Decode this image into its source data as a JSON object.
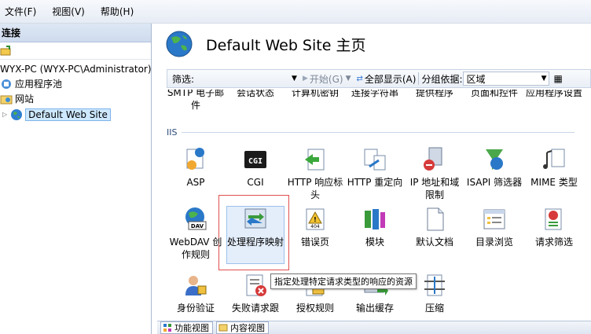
{
  "menu": [
    "文件(F)",
    "视图(V)",
    "帮助(H)"
  ],
  "left": {
    "header": "连接",
    "tree": [
      {
        "label": "WYX-PC (WYX-PC\\Administrator)",
        "icon": "server-icon"
      },
      {
        "label": "应用程序池",
        "icon": "app-pool-icon"
      },
      {
        "label": "网站",
        "icon": "sites-folder-icon"
      },
      {
        "label": "Default Web Site",
        "icon": "globe-icon",
        "selected": true
      }
    ]
  },
  "right": {
    "title": "Default Web Site 主页",
    "filter": {
      "label": "筛选:",
      "start": "开始(G)",
      "show_all": "全部显示(A)",
      "group_by_label": "分组依据:",
      "group_by_value": "区域"
    },
    "section_iis": "IIS",
    "row0": [
      "SMTP 电子邮件",
      "会话状态",
      "计算机密钥",
      "连接字符串",
      "提供程序",
      "页面和控件",
      "应用程序设置"
    ],
    "row1": [
      "ASP",
      "CGI",
      "HTTP 响应标头",
      "HTTP 重定向",
      "IP 地址和域限制",
      "ISAPI 筛选器",
      "MIME 类型"
    ],
    "row2": [
      "WebDAV 创作规则",
      "处理程序映射",
      "错误页",
      "模块",
      "默认文档",
      "目录浏览",
      "请求筛选"
    ],
    "row3": [
      "身份验证",
      "失败请求跟",
      "授权规则",
      "输出缓存",
      "压缩"
    ],
    "tooltip": "指定处理特定请求类型的响应的资源"
  },
  "bottom": {
    "features_view": "功能视图",
    "content_view": "内容视图"
  },
  "colors": {
    "selection": "#cde8ff",
    "highlight_box": "#e05050"
  }
}
